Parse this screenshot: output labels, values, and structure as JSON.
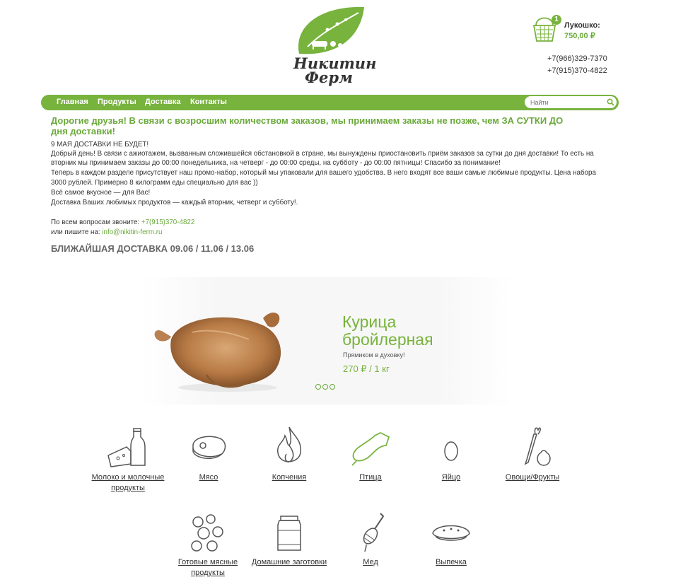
{
  "brand": {
    "name_line1": "Никитин",
    "name_line2": "Ферм",
    "colors": {
      "accent": "#77b33d",
      "text": "#333333"
    }
  },
  "basket": {
    "count": "1",
    "title": "Лукошко:",
    "total": "750,00 ₽"
  },
  "phones": [
    "+7(966)329-7370",
    "+7(915)370-4822"
  ],
  "nav": {
    "items": [
      "Главная",
      "Продукты",
      "Доставка",
      "Контакты"
    ],
    "search_placeholder": "Найти"
  },
  "headline": "Дорогие друзья! В связи с возросшим количеством заказов, мы принимаем заказы не позже, чем ЗА СУТКИ ДО дня доставки!",
  "notice": [
    "9 МАЯ ДОСТАВКИ НЕ БУДЕТ!",
    "Добрый день! В связи с ажиотажем, вызванным сложившейся обстановкой в стране, мы вынуждены приостановить приём заказов за сутки до дня доставки! То есть на",
    "вторник мы принимаем заказы до 00:00 понедельника, на четверг - до 00:00 среды, на субботу - до 00:00 пятницы! Спасибо за понимание!",
    "Теперь в каждом разделе присутствует наш промо-набор, который мы упаковали для вашего удобства. В него входят все ваши самые любимые продукты. Цена набора",
    "3000 рублей. Примерно 8 килограмм еды специально для вас ))",
    "Всё самое вкусное — для Вас!",
    "Доставка Ваших любимых продуктов — каждый вторник, четверг и субботу!."
  ],
  "contact": {
    "call_text": "По всем вопросам звоните: ",
    "phone": "+7(915)370-4822",
    "write_text": "или пишите на: ",
    "email": "info@nikitin-ferm.ru"
  },
  "delivery": "БЛИЖАЙШАЯ ДОСТАВКА 09.06 / 11.06 / 13.06",
  "slider": {
    "title_line1": "Курица",
    "title_line2": "бройлерная",
    "subtitle": "Прямиком в духовку!",
    "price": "270 ₽ / 1 кг"
  },
  "categories": [
    {
      "label_line1": "Молоко и молочные",
      "label_line2": "продукты",
      "icon": "milk-cheese-icon"
    },
    {
      "label_line1": "Мясо",
      "label_line2": "",
      "icon": "meat-icon"
    },
    {
      "label_line1": "Копчения",
      "label_line2": "",
      "icon": "fire-icon"
    },
    {
      "label_line1": "Птица",
      "label_line2": "",
      "icon": "drumstick-icon"
    },
    {
      "label_line1": "Яйцо",
      "label_line2": "",
      "icon": "egg-icon"
    },
    {
      "label_line1": "Овощи/Фрукты",
      "label_line2": "",
      "icon": "carrot-garlic-icon"
    },
    {
      "label_line1": "Готовые мясные",
      "label_line2": "продукты",
      "icon": "dumplings-icon"
    },
    {
      "label_line1": "Домашние заготовки",
      "label_line2": "",
      "icon": "jar-icon"
    },
    {
      "label_line1": "Мед",
      "label_line2": "",
      "icon": "honey-dipper-icon"
    },
    {
      "label_line1": "Выпечка",
      "label_line2": "",
      "icon": "pie-icon"
    }
  ]
}
